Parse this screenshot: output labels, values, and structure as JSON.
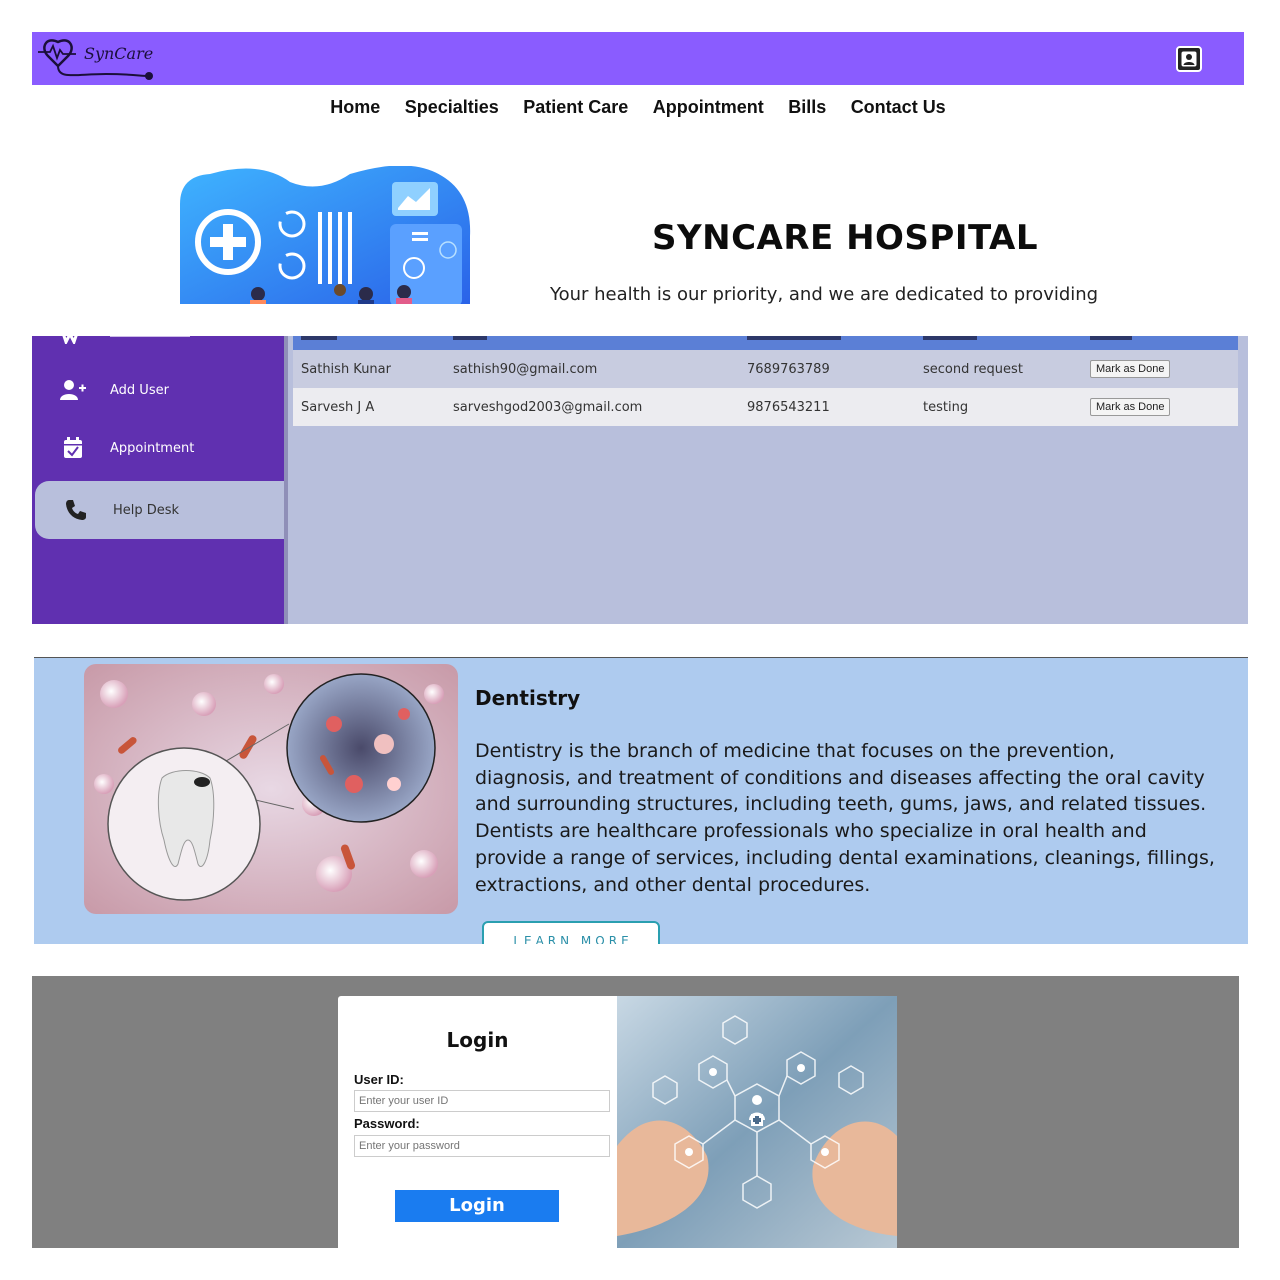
{
  "home": {
    "brand": "SynCare",
    "nav": [
      "Home",
      "Specialties",
      "Patient Care",
      "Appointment",
      "Bills",
      "Contact Us"
    ],
    "title": "SYNCARE HOSPITAL",
    "subtitle": "Your health is our priority, and we are dedicated to providing",
    "profile_icon": "user-profile-icon",
    "colors": {
      "header": "#8a5cff"
    }
  },
  "admin": {
    "sidebar": [
      {
        "label": "Add User",
        "icon": "add-user-icon"
      },
      {
        "label": "Appointment",
        "icon": "calendar-check-icon"
      },
      {
        "label": "Help Desk",
        "icon": "phone-icon"
      }
    ],
    "rows": [
      {
        "name": "Sathish Kunar",
        "email": "sathish90@gmail.com",
        "phone": "7689763789",
        "message": "second request",
        "action": "Mark as Done"
      },
      {
        "name": "Sarvesh J A",
        "email": "sarveshgod2003@gmail.com",
        "phone": "9876543211",
        "message": "testing",
        "action": "Mark as Done"
      }
    ],
    "colors": {
      "sidebar": "#6030b0",
      "content": "#b8bfdc",
      "table_header": "#5b7fd6"
    }
  },
  "specialty": {
    "title": "Dentistry",
    "description": "Dentistry is the branch of medicine that focuses on the prevention, diagnosis, and treatment of conditions and diseases affecting the oral cavity and surrounding structures, including teeth, gums, jaws, and related tissues. Dentists are healthcare professionals who specialize in oral health and provide a range of services, including dental examinations, cleanings, fillings, extractions, and other dental procedures.",
    "button": "LEARN MORE",
    "colors": {
      "background": "#aecbef"
    }
  },
  "login": {
    "title": "Login",
    "user_label": "User ID:",
    "user_placeholder": "Enter your user ID",
    "password_label": "Password:",
    "password_placeholder": "Enter your password",
    "submit": "Login",
    "colors": {
      "button": "#1a7cf0"
    }
  }
}
